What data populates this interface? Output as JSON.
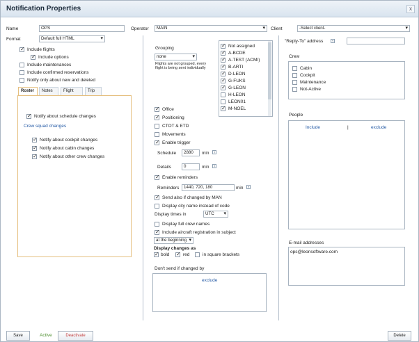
{
  "window": {
    "title": "Notification Properties",
    "close": "x"
  },
  "left": {
    "name_label": "Name",
    "name_value": "OPS",
    "format_label": "Format",
    "format_value": "Default full HTML",
    "options": [
      {
        "label": "Include flights",
        "checked": true
      },
      {
        "label": "Include options",
        "checked": true
      },
      {
        "label": "Include maintenances",
        "checked": false
      },
      {
        "label": "Include confirmed reservations",
        "checked": false
      },
      {
        "label": "Notify only about new and deleted",
        "checked": false
      }
    ],
    "tabs": [
      "Roster",
      "Notes",
      "Flight",
      "Trip"
    ],
    "roster": {
      "notify_schedule": "Notify about schedule changes",
      "crew_squad": "Crew squad changes",
      "items": [
        "Notify about cockpit changes",
        "Notify about cabin changes",
        "Notify about other crew changes"
      ]
    }
  },
  "middle": {
    "operator_label": "Operator",
    "operator_value": "MAIN",
    "grouping_label": "Grouping",
    "grouping_value": "none",
    "grouping_note": "Flights are not grouped, every flight is being sent individually",
    "aircraft": [
      {
        "label": "Not assigned",
        "checked": true
      },
      {
        "label": "A-BCDE",
        "checked": true
      },
      {
        "label": "A-TEST (ACMI)",
        "checked": true
      },
      {
        "label": "B-ARTI",
        "checked": true
      },
      {
        "label": "D-LEON",
        "checked": true
      },
      {
        "label": "G-FUKS",
        "checked": true
      },
      {
        "label": "G-LEON",
        "checked": true
      },
      {
        "label": "H-LEON",
        "checked": false
      },
      {
        "label": "LEON01",
        "checked": false
      },
      {
        "label": "M-NOEL",
        "checked": true
      }
    ],
    "notify_opts": [
      {
        "label": "Office",
        "checked": true
      },
      {
        "label": "Positioning",
        "checked": true
      },
      {
        "label": "CTOT & ETD",
        "checked": false
      },
      {
        "label": "Movements",
        "checked": false
      },
      {
        "label": "Enable trigger",
        "checked": true
      }
    ],
    "schedule_label": "Schedule",
    "schedule_value": "2880",
    "details_label": "Details",
    "details_value": "0",
    "min": "min",
    "reminders_label": "Enable reminders",
    "reminders_label2": "Reminders",
    "reminders_value": "1440, 720, 180",
    "send_changed": "Send also if changed by MAN",
    "display_city": "Display city name instead of code",
    "display_times_label": "Display times in",
    "display_times_value": "UTC",
    "display_full_crew": "Display full crew names",
    "include_registration": "Include aircraft registration in subject",
    "registration_position": "at the beginning",
    "display_changes_as": "Display changes as",
    "bold": "bold",
    "red": "red",
    "square": "in square brackets",
    "dont_send_label": "Don't send if changed by",
    "exclude": "exclude"
  },
  "right": {
    "client_label": "Client",
    "client_value": "-Select client-",
    "reply_to_label": "\"Reply-To\" address",
    "crew_label": "Crew",
    "crew_items": [
      "Cabin",
      "Cockpit",
      "Maintenance",
      "Not-Active"
    ],
    "people_label": "People",
    "include": "Include",
    "sep": "|",
    "exclude": "exclude",
    "email_label": "E-mail addresses",
    "email_value": "ops@leonsoftware.com"
  },
  "footer": {
    "save": "Save",
    "active": "Active",
    "deactivate": "Deactivate",
    "delete": "Delete"
  },
  "icons": {
    "help": "?"
  }
}
